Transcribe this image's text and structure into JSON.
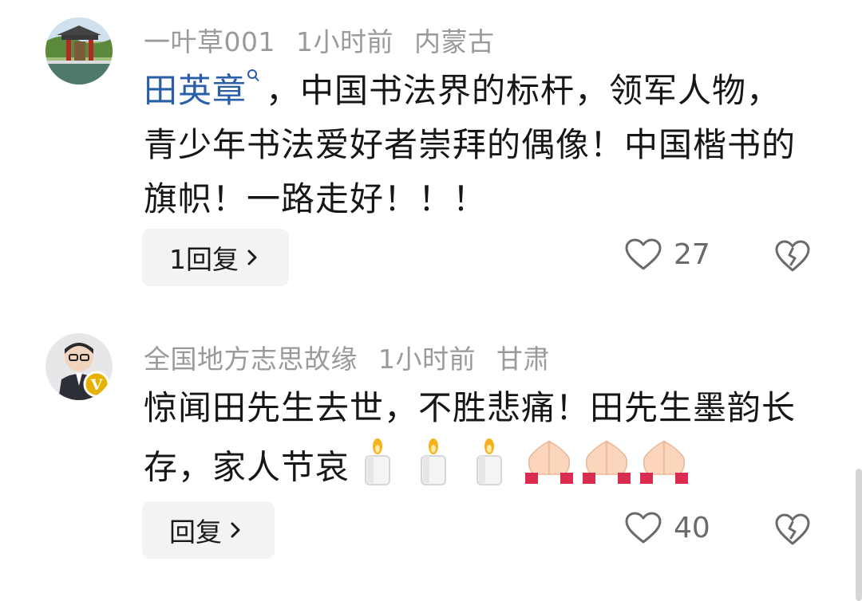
{
  "comments": [
    {
      "username": "一叶草001",
      "time": "1小时前",
      "location": "内蒙古",
      "mention": "田英章",
      "text": "，中国书法界的标杆，领军人物，青少年书法爱好者崇拜的偶像！中国楷书的旗帜！一路走好！！！",
      "reply_label": "1回复",
      "likes": "27"
    },
    {
      "username": "全国地方志思故缘",
      "time": "1小时前",
      "location": "甘肃",
      "text": "惊闻田先生去世，不胜悲痛！田先生墨韵长存，家人节哀",
      "reply_label": "回复",
      "likes": "40",
      "badge": "V"
    }
  ],
  "icons": {
    "mention": "search-icon",
    "like": "heart-outline-icon",
    "dislike": "broken-heart-icon",
    "reply": "chevron-right-icon",
    "emoji_candle": "candle-emoji",
    "emoji_pray": "folded-hands-emoji"
  },
  "colors": {
    "mention": "#2a5fa8",
    "meta": "#9a9a9a",
    "badge": "#e8b100",
    "reply_bg": "#f2f3f5"
  }
}
